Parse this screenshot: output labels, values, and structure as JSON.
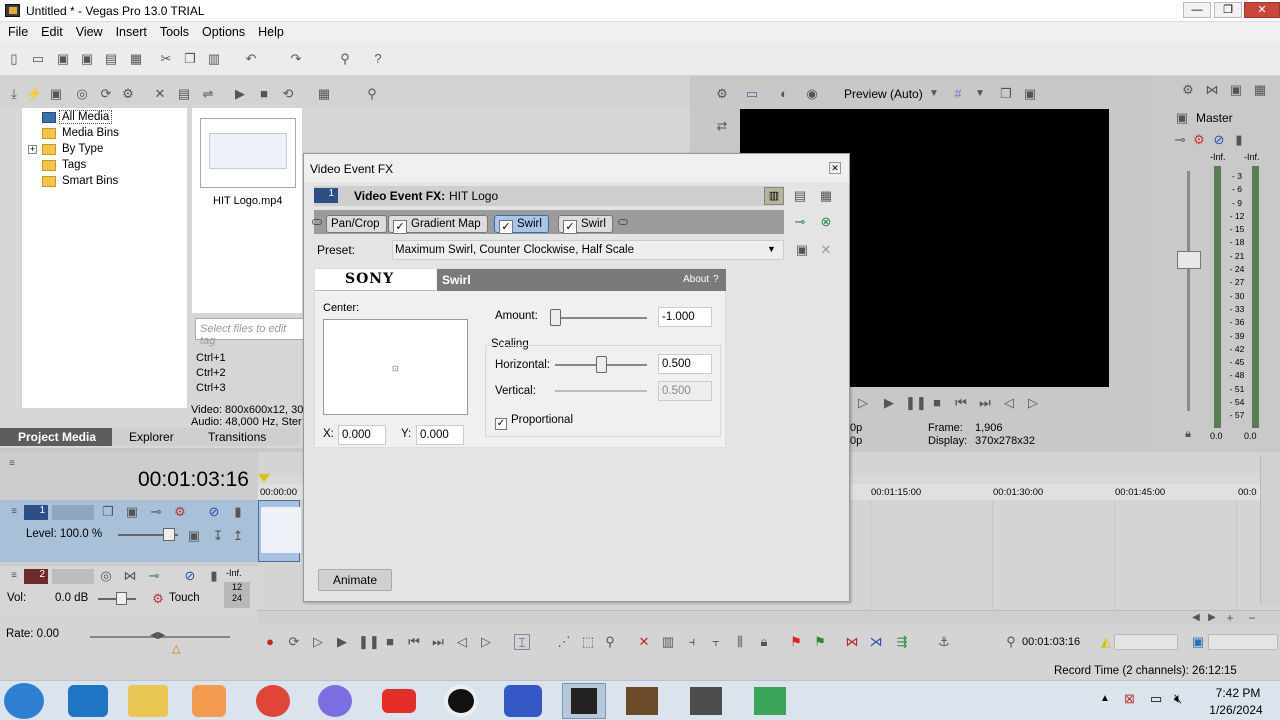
{
  "window": {
    "title": "Untitled * - Vegas Pro 13.0 TRIAL",
    "minimize": "—",
    "maximize": "❐",
    "close": "✕"
  },
  "menu": [
    "File",
    "Edit",
    "View",
    "Insert",
    "Tools",
    "Options",
    "Help"
  ],
  "explorer": {
    "tree": [
      "All Media",
      "Media Bins",
      "By Type",
      "Tags",
      "Smart Bins"
    ],
    "expander": "+",
    "media_file": "HIT Logo.mp4",
    "tag_placeholder": "Select files to edit tag",
    "shortcuts": [
      "Ctrl+1",
      "Ctrl+2",
      "Ctrl+3"
    ],
    "info": [
      "Video: 800x600x12, 30",
      "Audio: 48,000 Hz, Ster"
    ],
    "tabs": [
      "Project Media",
      "Explorer",
      "Transitions"
    ]
  },
  "dialog": {
    "title": "Video Event FX",
    "close": "✕",
    "track_num": "1",
    "header_label": "Video Event FX:",
    "header_value": "HIT Logo",
    "chain": [
      "Pan/Crop",
      "Gradient Map",
      "Swirl",
      "Swirl"
    ],
    "preset_label": "Preset:",
    "preset_value": "Maximum Swirl, Counter Clockwise, Half Scale",
    "brand": "SONY",
    "plugin": "Swirl",
    "about": "About",
    "about_q": "?",
    "center_label": "Center:",
    "x_label": "X:",
    "x_value": "0.000",
    "y_label": "Y:",
    "y_value": "0.000",
    "amount_label": "Amount:",
    "amount_value": "-1.000",
    "amount_level": 0,
    "scaling_label": "Scaling",
    "horizontal_label": "Horizontal:",
    "horizontal_value": "0.500",
    "horizontal_level": 0.5,
    "vertical_label": "Vertical:",
    "vertical_value": "0.500",
    "proportional_label": "Proportional",
    "proportional_checked": true,
    "animate": "Animate"
  },
  "preview": {
    "mode": "Preview (Auto)",
    "frame_label": "Frame:",
    "frame_value": "1,906",
    "display_label": "Display:",
    "display_value": "370x278x32",
    "left_a": "0p",
    "left_b": "0p"
  },
  "mixer": {
    "master": "Master",
    "inf_left": "-Inf.",
    "inf_right": "-Inf.",
    "scale": [
      "3",
      "6",
      "9",
      "12",
      "15",
      "18",
      "21",
      "24",
      "27",
      "30",
      "33",
      "36",
      "39",
      "42",
      "45",
      "48",
      "51",
      "54",
      "57"
    ],
    "bottom_left": "0.0",
    "bottom_right": "0.0"
  },
  "timeline": {
    "timecode": "00:01:03:16",
    "ruler_start": "00:00:00",
    "ruler": [
      "00:01:15:00",
      "00:01:30:00",
      "00:01:45:00",
      "00:0"
    ],
    "track1": {
      "num": "1",
      "level": "Level: 100.0 %"
    },
    "track2": {
      "num": "2",
      "vol": "Vol:",
      "vol_value": "0.0 dB",
      "touch": "Touch",
      "inf": "-Inf.",
      "meter_a": "12",
      "meter_b": "24"
    },
    "rate": "Rate: 0.00",
    "transport_timecode": "00:01:03:16",
    "record_time": "Record Time (2 channels): 26:12:15"
  },
  "taskbar": {
    "time": "7:42 PM",
    "date": "1/26/2024"
  }
}
